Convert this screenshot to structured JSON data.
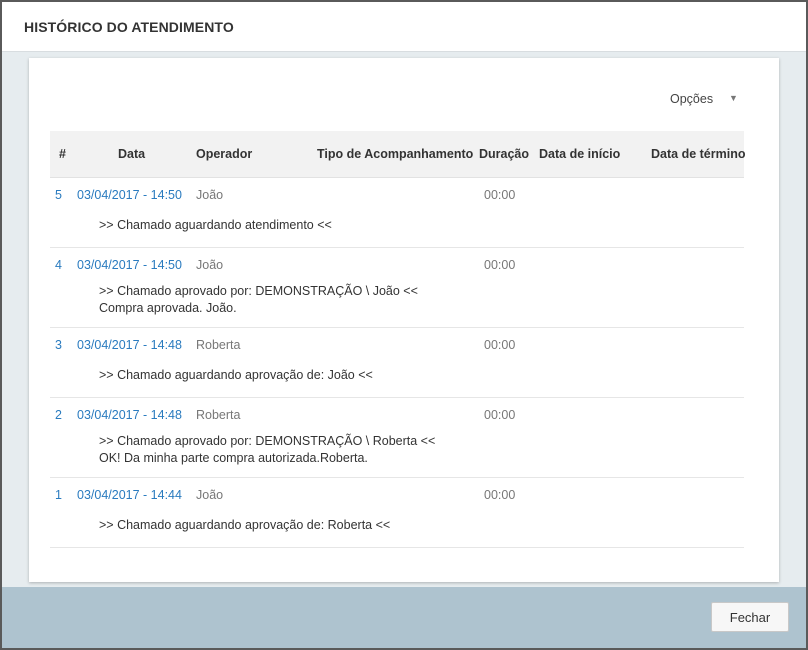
{
  "dialog": {
    "title": "HISTÓRICO DO ATENDIMENTO",
    "options_label": "Opções",
    "close_label": "Fechar"
  },
  "columns": {
    "num": "#",
    "data": "Data",
    "operador": "Operador",
    "tipo": "Tipo de Acompanhamento",
    "duracao": "Duração",
    "inicio": "Data de início",
    "termino": "Data de término"
  },
  "rows": [
    {
      "num": "5",
      "data": "03/04/2017 - 14:50",
      "operador": "João",
      "duracao": "00:00",
      "desc": [
        ">> Chamado aguardando atendimento <<"
      ]
    },
    {
      "num": "4",
      "data": "03/04/2017 - 14:50",
      "operador": "João",
      "duracao": "00:00",
      "desc": [
        ">> Chamado aprovado por: DEMONSTRAÇÃO \\ João <<",
        "Compra aprovada. João."
      ]
    },
    {
      "num": "3",
      "data": "03/04/2017 - 14:48",
      "operador": "Roberta",
      "duracao": "00:00",
      "desc": [
        ">> Chamado aguardando aprovação de: João <<"
      ]
    },
    {
      "num": "2",
      "data": "03/04/2017 - 14:48",
      "operador": "Roberta",
      "duracao": "00:00",
      "desc": [
        ">> Chamado aprovado por: DEMONSTRAÇÃO \\ Roberta <<",
        "OK! Da minha parte compra autorizada.Roberta."
      ]
    },
    {
      "num": "1",
      "data": "03/04/2017 - 14:44",
      "operador": "João",
      "duracao": "00:00",
      "desc": [
        ">> Chamado aguardando aprovação de: Roberta <<"
      ]
    }
  ]
}
